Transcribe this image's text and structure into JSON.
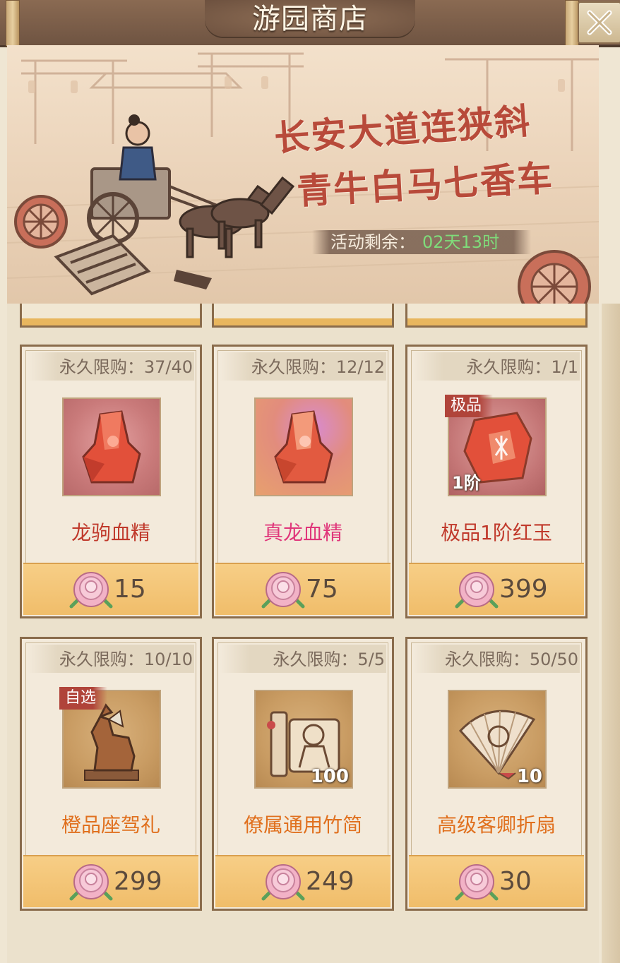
{
  "window": {
    "title": "游园商店",
    "close_icon": "close-icon"
  },
  "banner": {
    "poem_line_1": "长安大道连狭斜",
    "poem_line_2": "青牛白马七香车",
    "timer_label": "活动剩余：",
    "timer_value": "02天13时",
    "timer_value_color": "#7fdc7a"
  },
  "currency": {
    "icon": "peony-flower-icon"
  },
  "items": [
    {
      "limit": "永久限购：37/40",
      "name": "龙驹血精",
      "name_color": "#c0392b",
      "price": "15",
      "icon": "red-crystal-icon",
      "tag": "",
      "quantity": "",
      "grade": ""
    },
    {
      "limit": "永久限购：12/12",
      "name": "真龙血精",
      "name_color": "#e0357a",
      "price": "75",
      "icon": "red-crystal-icon",
      "tag": "",
      "quantity": "",
      "grade": ""
    },
    {
      "limit": "永久限购：1/1",
      "name": "极品1阶红玉",
      "name_color": "#c0392b",
      "price": "399",
      "icon": "red-jade-icon",
      "tag": "极品",
      "quantity": "",
      "grade": "1阶"
    },
    {
      "limit": "永久限购：10/10",
      "name": "橙品座驾礼",
      "name_color": "#e0701e",
      "price": "299",
      "icon": "horse-statue-icon",
      "tag": "自选",
      "quantity": "",
      "grade": ""
    },
    {
      "limit": "永久限购：5/5",
      "name": "僚属通用竹简",
      "name_color": "#e0701e",
      "price": "249",
      "icon": "bamboo-scroll-icon",
      "tag": "",
      "quantity": "100",
      "grade": ""
    },
    {
      "limit": "永久限购：50/50",
      "name": "高级客卿折扇",
      "name_color": "#e0701e",
      "price": "30",
      "icon": "folding-fan-icon",
      "tag": "",
      "quantity": "10",
      "grade": ""
    }
  ]
}
